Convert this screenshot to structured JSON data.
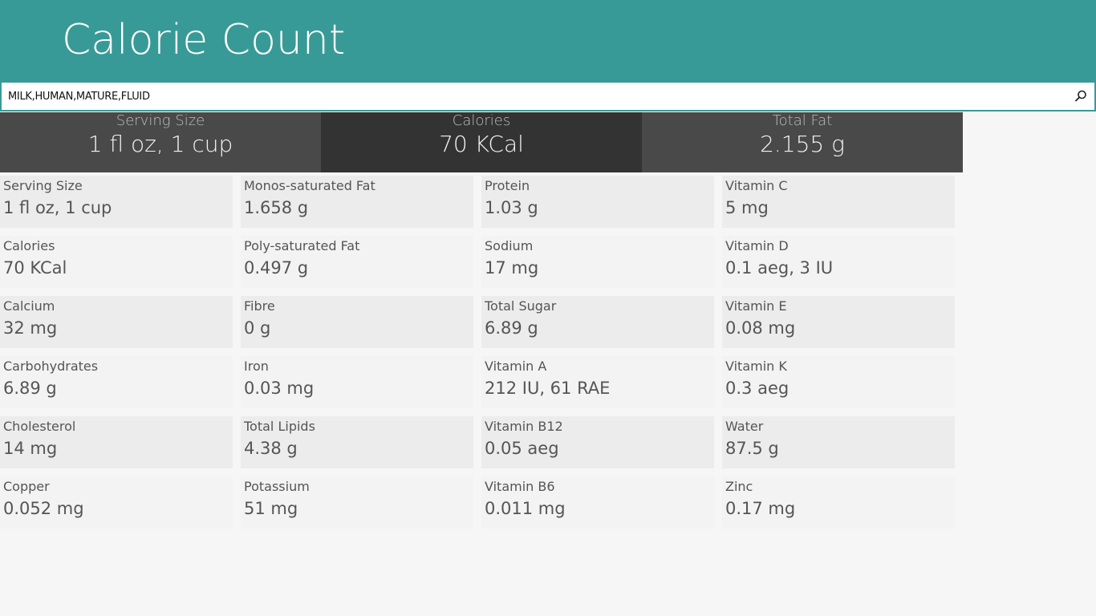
{
  "app": {
    "title": "Calorie Count"
  },
  "search": {
    "value": "MILK,HUMAN,MATURE,FLUID",
    "placeholder": ""
  },
  "summary": [
    {
      "label": "Serving Size",
      "value": "1 fl oz, 1 cup"
    },
    {
      "label": "Calories",
      "value": "70 KCal"
    },
    {
      "label": "Total Fat",
      "value": "2.155 g"
    }
  ],
  "nutrients": [
    [
      {
        "label": "Serving Size",
        "value": "1 fl oz, 1 cup"
      },
      {
        "label": "Calories",
        "value": "70 KCal"
      },
      {
        "label": "Calcium",
        "value": "32 mg"
      },
      {
        "label": "Carbohydrates",
        "value": "6.89 g"
      },
      {
        "label": "Cholesterol",
        "value": "14 mg"
      },
      {
        "label": "Copper",
        "value": "0.052 mg"
      }
    ],
    [
      {
        "label": "Monos-saturated Fat",
        "value": "1.658 g"
      },
      {
        "label": "Poly-saturated Fat",
        "value": "0.497 g"
      },
      {
        "label": "Fibre",
        "value": "0 g"
      },
      {
        "label": "Iron",
        "value": "0.03 mg"
      },
      {
        "label": "Total Lipids",
        "value": "4.38 g"
      },
      {
        "label": "Potassium",
        "value": "51 mg"
      }
    ],
    [
      {
        "label": "Protein",
        "value": "1.03 g"
      },
      {
        "label": "Sodium",
        "value": "17 mg"
      },
      {
        "label": "Total Sugar",
        "value": "6.89 g"
      },
      {
        "label": "Vitamin A",
        "value": "212 IU, 61 RAE"
      },
      {
        "label": "Vitamin B12",
        "value": "0.05 aeg"
      },
      {
        "label": "Vitamin B6",
        "value": "0.011 mg"
      }
    ],
    [
      {
        "label": "Vitamin C",
        "value": "5 mg"
      },
      {
        "label": "Vitamin D",
        "value": "0.1 aeg, 3 IU"
      },
      {
        "label": "Vitamin E",
        "value": "0.08 mg"
      },
      {
        "label": "Vitamin K",
        "value": "0.3 aeg"
      },
      {
        "label": "Water",
        "value": "87.5 g"
      },
      {
        "label": "Zinc",
        "value": "0.17 mg"
      }
    ]
  ],
  "colors": {
    "header": "#389a97",
    "summary_dark": "#333333",
    "summary_mid": "#494949",
    "background": "#f6f6f6"
  },
  "icons": {
    "search": "search-icon"
  }
}
